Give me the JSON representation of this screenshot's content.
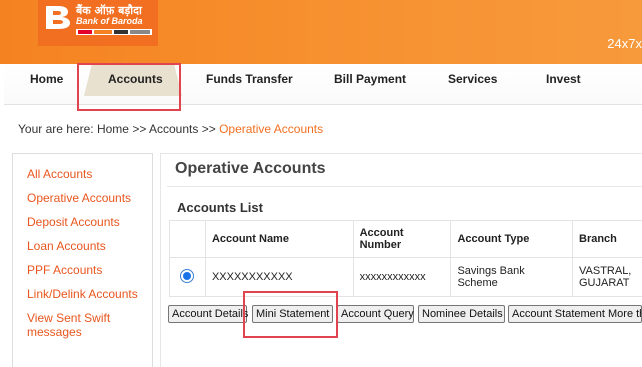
{
  "header": {
    "bank_name_hindi": "बैंक ऑफ़ बड़ौदा",
    "bank_name": "Bank of Baroda",
    "tagline": "24x7x",
    "brand_color": "#f58220"
  },
  "nav": {
    "items": [
      {
        "label": "Home"
      },
      {
        "label": "Accounts"
      },
      {
        "label": "Funds Transfer"
      },
      {
        "label": "Bill Payment"
      },
      {
        "label": "Services"
      },
      {
        "label": "Invest"
      }
    ],
    "active": "Accounts"
  },
  "breadcrumb": {
    "prefix": "Your are here:",
    "home": "Home",
    "sep": ">>",
    "accounts": "Accounts",
    "current": "Operative Accounts"
  },
  "sidebar": {
    "items": [
      {
        "label": "All Accounts"
      },
      {
        "label": "Operative Accounts"
      },
      {
        "label": "Deposit Accounts"
      },
      {
        "label": "Loan Accounts"
      },
      {
        "label": "PPF Accounts"
      },
      {
        "label": "Link/Delink Accounts"
      },
      {
        "label": "View Sent Swift messages"
      }
    ]
  },
  "main": {
    "title": "Operative Accounts",
    "list_title": "Accounts List",
    "columns": [
      "Account Name",
      "Account Number",
      "Account Type",
      "Branch"
    ],
    "rows": [
      {
        "selected": true,
        "account_name": "XXXXXXXXXXX",
        "account_number": "xxxxxxxxxxxx",
        "account_type": "Savings Bank Scheme",
        "branch": "VASTRAL, GUJARAT"
      }
    ]
  },
  "buttons": {
    "account_details": "Account Details",
    "mini_statement": "Mini Statement",
    "account_query": "Account Query",
    "nominee_details": "Nominee Details",
    "account_statement": "Account Statement More th"
  }
}
